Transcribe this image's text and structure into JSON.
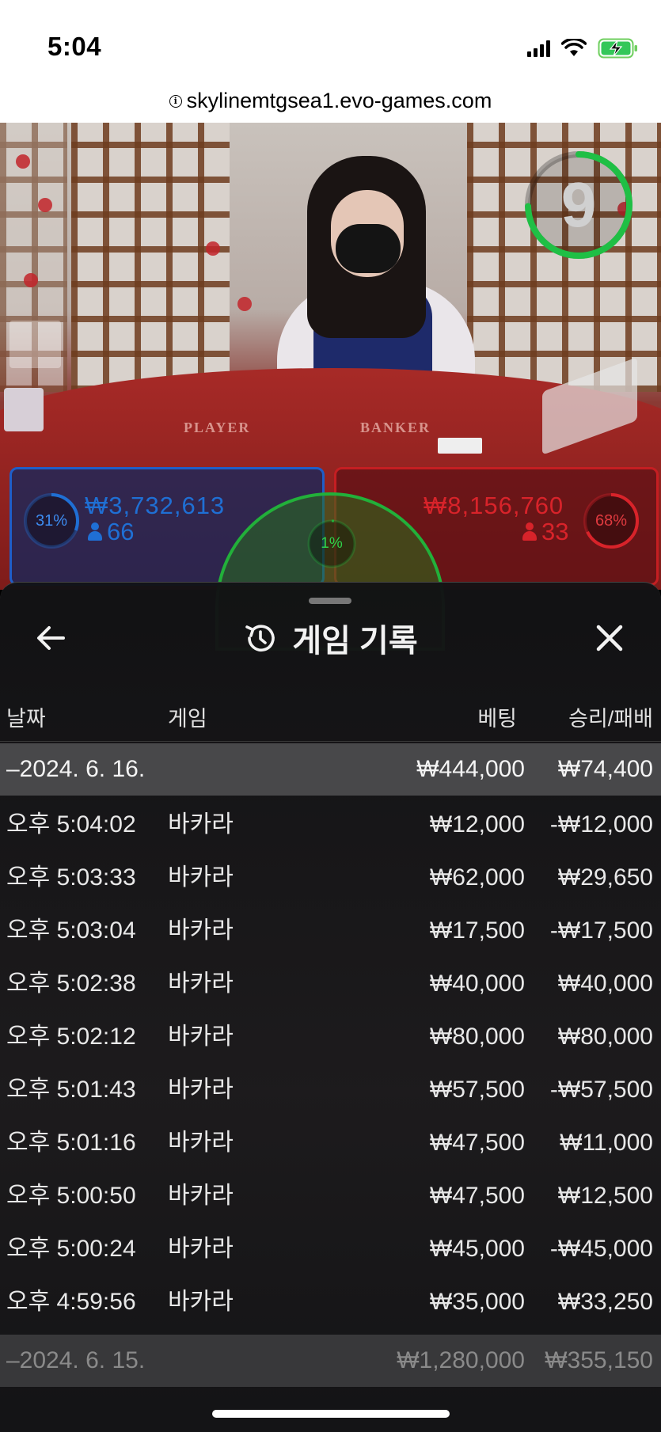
{
  "status_bar": {
    "time": "5:04",
    "icons": [
      "signal-icon",
      "wifi-icon",
      "battery-charging-icon"
    ]
  },
  "url_bar": {
    "url": "skylinemtgsea1.evo-games.com",
    "icon": "info-icon"
  },
  "video": {
    "felt_labels": [
      "PLAYER",
      "BANKER"
    ],
    "timer": {
      "value": "9",
      "color": "#1fbf45"
    }
  },
  "bets": {
    "player": {
      "percent": "31%",
      "amount": "₩3,732,613",
      "players": "66",
      "color": "#1f6fd4"
    },
    "banker": {
      "percent": "68%",
      "amount": "₩8,156,760",
      "players": "33",
      "color": "#d8232a"
    },
    "tie": {
      "percent": "1%",
      "color": "#22b03a"
    }
  },
  "history": {
    "title": "게임 기록",
    "title_icon": "history-icon",
    "back_icon": "arrow-left-icon",
    "close_icon": "close-icon",
    "columns": {
      "date": "날짜",
      "game": "게임",
      "bet": "베팅",
      "win_loss": "승리/패배"
    },
    "day1": {
      "date": "–2024. 6. 16.",
      "bet": "₩444,000",
      "win_loss": "₩74,400"
    },
    "rows": [
      {
        "time": "오후 5:04:02",
        "game": "바카라",
        "bet": "₩12,000",
        "win_loss": "-₩12,000"
      },
      {
        "time": "오후 5:03:33",
        "game": "바카라",
        "bet": "₩62,000",
        "win_loss": "₩29,650"
      },
      {
        "time": "오후 5:03:04",
        "game": "바카라",
        "bet": "₩17,500",
        "win_loss": "-₩17,500"
      },
      {
        "time": "오후 5:02:38",
        "game": "바카라",
        "bet": "₩40,000",
        "win_loss": "₩40,000"
      },
      {
        "time": "오후 5:02:12",
        "game": "바카라",
        "bet": "₩80,000",
        "win_loss": "₩80,000"
      },
      {
        "time": "오후 5:01:43",
        "game": "바카라",
        "bet": "₩57,500",
        "win_loss": "-₩57,500"
      },
      {
        "time": "오후 5:01:16",
        "game": "바카라",
        "bet": "₩47,500",
        "win_loss": "₩11,000"
      },
      {
        "time": "오후 5:00:50",
        "game": "바카라",
        "bet": "₩47,500",
        "win_loss": "₩12,500"
      },
      {
        "time": "오후 5:00:24",
        "game": "바카라",
        "bet": "₩45,000",
        "win_loss": "-₩45,000"
      },
      {
        "time": "오후 4:59:56",
        "game": "바카라",
        "bet": "₩35,000",
        "win_loss": "₩33,250"
      }
    ],
    "day2": {
      "date": "–2024. 6. 15.",
      "bet": "₩1,280,000",
      "win_loss": "₩355,150"
    }
  }
}
